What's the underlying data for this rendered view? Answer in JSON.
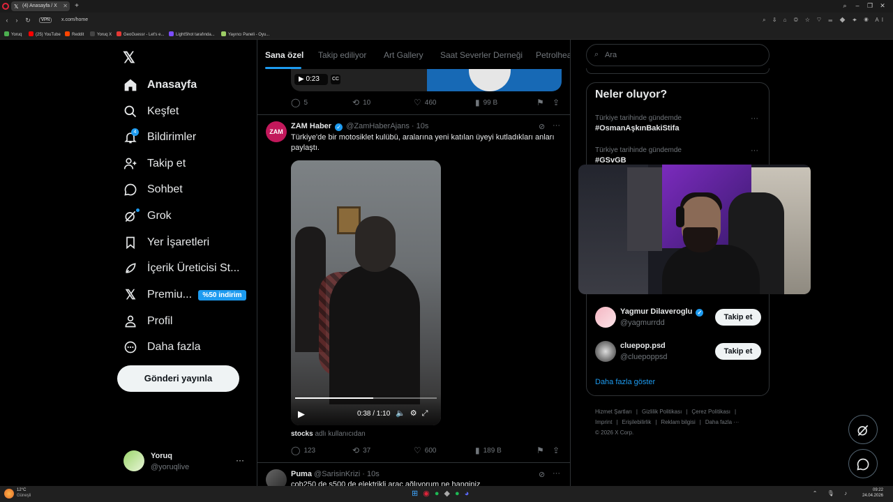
{
  "browser": {
    "tab_title": "(4) Anasayfa / X",
    "url": "x.com/home",
    "vpn_label": "VPN",
    "bookmarks": [
      "Yoruq",
      "(25) YouTube",
      "Reddit",
      "Yoruq X",
      "GeoGuessr - Let's e...",
      "LightShot tarafında...",
      "Yayıncı Paneli - Oyu..."
    ]
  },
  "nav": {
    "items": [
      {
        "label": "Anasayfa",
        "icon": "home-icon"
      },
      {
        "label": "Keşfet",
        "icon": "search-icon"
      },
      {
        "label": "Bildirimler",
        "icon": "bell-icon"
      },
      {
        "label": "Takip et",
        "icon": "person-add-icon"
      },
      {
        "label": "Sohbet",
        "icon": "chat-bubble-icon"
      },
      {
        "label": "Grok",
        "icon": "grok-icon"
      },
      {
        "label": "Yer İşaretleri",
        "icon": "bookmark-icon"
      },
      {
        "label": "İçerik Üreticisi St...",
        "icon": "rocket-icon"
      },
      {
        "label": "Premiu...",
        "icon": "x-icon"
      },
      {
        "label": "Profil",
        "icon": "person-icon"
      },
      {
        "label": "Daha fazla",
        "icon": "more-circle-icon"
      }
    ],
    "notification_count": "4",
    "premium_badge": "%50 indirim",
    "post_button": "Gönderi yayınla"
  },
  "account": {
    "name": "Yoruq",
    "handle": "@yoruqlive"
  },
  "feed": {
    "tabs": [
      "Sana özel",
      "Takip ediliyor",
      "Art Gallery",
      "Saat Severler Derneği",
      "Petrolhea"
    ],
    "prev_post": {
      "video_time": "0:23",
      "replies": "5",
      "reposts": "10",
      "likes": "460",
      "views": "99 B"
    },
    "posts": [
      {
        "name": "ZAM Haber",
        "avatar_text": "ZAM",
        "handle": "@ZamHaberAjans",
        "time": "· 10s",
        "text": "Türkiye'de bir motosiklet kulübü, aralarına yeni katılan üyeyi kutladıkları anları paylaştı.",
        "video": {
          "time": "0:38 / 1:10",
          "progress": 0.55
        },
        "caption_bold": "stocks",
        "caption_rest": " adlı kullanıcıdan",
        "replies": "123",
        "reposts": "37",
        "likes": "600",
        "views": "189 B"
      },
      {
        "name": "Puma",
        "handle": "@SarisinKrizi",
        "time": "· 10s",
        "text": "cob250 de s500 de elektrikli araç ağlıyorum ne hanginiz"
      }
    ]
  },
  "sidebar": {
    "search_placeholder": "Ara",
    "trends_title": "Neler oluyor?",
    "trends": [
      {
        "context": "Türkiye tarihinde gündemde",
        "tag": "#OsmanAşkınBakiStifa"
      },
      {
        "context": "Türkiye tarihinde gündemde",
        "tag": "#GSvGB"
      }
    ],
    "suggestions": [
      {
        "name": "Yagmur Dilaveroglu",
        "handle": "@yagmurrdd",
        "verified": true,
        "button": "Takip et"
      },
      {
        "name": "cluepop.psd",
        "handle": "@cluepoppsd",
        "verified": false,
        "button": "Takip et"
      }
    ],
    "show_more": "Daha fazla göster",
    "footer": [
      "Hizmet Şartları",
      "|",
      "Gizlilik Politikası",
      "|",
      "Çerez Politikası",
      "|",
      "Imprint",
      "|",
      "Erişilebilirlik",
      "|",
      "Reklam bilgisi",
      "|",
      "Daha fazla ···",
      "© 2026 X Corp."
    ]
  },
  "taskbar": {
    "temp": "12°C",
    "weather": "Güneşli",
    "time": "09:22",
    "date": "24.04.2026"
  },
  "colors": {
    "accent": "#1d9bf0",
    "background": "#000000",
    "border": "#2f3336",
    "muted": "#71767b"
  }
}
